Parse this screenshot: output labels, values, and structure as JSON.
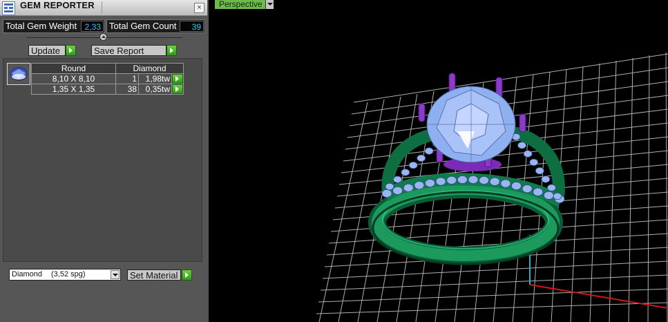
{
  "panel": {
    "title": "GEM REPORTER",
    "close_glyph": "×",
    "total_weight_label": "Total Gem Weight",
    "total_weight_value": "2,33",
    "total_count_label": "Total Gem Count",
    "total_count_value": "39",
    "update_label": "Update",
    "save_report_label": "Save Report",
    "table": {
      "headers": [
        "Round",
        "Diamond"
      ],
      "rows": [
        {
          "size": "8,10 X 8,10",
          "count": "1",
          "weight": "1,98tw"
        },
        {
          "size": "1,35 X 1,35",
          "count": "38",
          "weight": "0,35tw"
        }
      ]
    },
    "material_select": {
      "name": "Diamond",
      "spg": "(3,52 spg)"
    },
    "set_material_label": "Set Material"
  },
  "viewport": {
    "view_label": "Perspective"
  },
  "colors": {
    "accent_value": "#36c7f4",
    "button_green": "#3aa824",
    "ring_green": "#0f7a4a",
    "gem_blue": "#8fb0f0",
    "prong_purple": "#8a3cc8"
  }
}
